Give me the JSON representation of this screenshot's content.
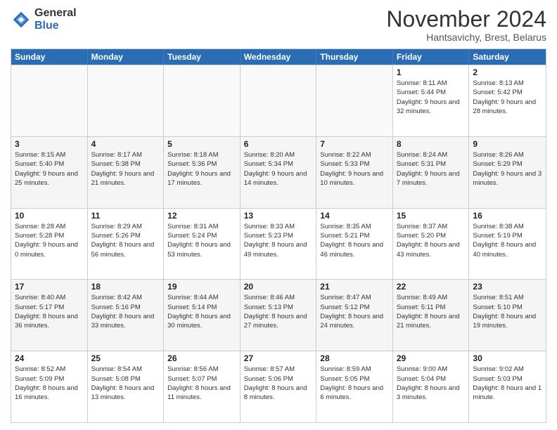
{
  "logo": {
    "general": "General",
    "blue": "Blue"
  },
  "title": "November 2024",
  "subtitle": "Hantsavichy, Brest, Belarus",
  "days": [
    "Sunday",
    "Monday",
    "Tuesday",
    "Wednesday",
    "Thursday",
    "Friday",
    "Saturday"
  ],
  "weeks": [
    [
      {
        "day": "",
        "info": ""
      },
      {
        "day": "",
        "info": ""
      },
      {
        "day": "",
        "info": ""
      },
      {
        "day": "",
        "info": ""
      },
      {
        "day": "",
        "info": ""
      },
      {
        "day": "1",
        "info": "Sunrise: 8:11 AM\nSunset: 5:44 PM\nDaylight: 9 hours and 32 minutes."
      },
      {
        "day": "2",
        "info": "Sunrise: 8:13 AM\nSunset: 5:42 PM\nDaylight: 9 hours and 28 minutes."
      }
    ],
    [
      {
        "day": "3",
        "info": "Sunrise: 8:15 AM\nSunset: 5:40 PM\nDaylight: 9 hours and 25 minutes."
      },
      {
        "day": "4",
        "info": "Sunrise: 8:17 AM\nSunset: 5:38 PM\nDaylight: 9 hours and 21 minutes."
      },
      {
        "day": "5",
        "info": "Sunrise: 8:18 AM\nSunset: 5:36 PM\nDaylight: 9 hours and 17 minutes."
      },
      {
        "day": "6",
        "info": "Sunrise: 8:20 AM\nSunset: 5:34 PM\nDaylight: 9 hours and 14 minutes."
      },
      {
        "day": "7",
        "info": "Sunrise: 8:22 AM\nSunset: 5:33 PM\nDaylight: 9 hours and 10 minutes."
      },
      {
        "day": "8",
        "info": "Sunrise: 8:24 AM\nSunset: 5:31 PM\nDaylight: 9 hours and 7 minutes."
      },
      {
        "day": "9",
        "info": "Sunrise: 8:26 AM\nSunset: 5:29 PM\nDaylight: 9 hours and 3 minutes."
      }
    ],
    [
      {
        "day": "10",
        "info": "Sunrise: 8:28 AM\nSunset: 5:28 PM\nDaylight: 9 hours and 0 minutes."
      },
      {
        "day": "11",
        "info": "Sunrise: 8:29 AM\nSunset: 5:26 PM\nDaylight: 8 hours and 56 minutes."
      },
      {
        "day": "12",
        "info": "Sunrise: 8:31 AM\nSunset: 5:24 PM\nDaylight: 8 hours and 53 minutes."
      },
      {
        "day": "13",
        "info": "Sunrise: 8:33 AM\nSunset: 5:23 PM\nDaylight: 8 hours and 49 minutes."
      },
      {
        "day": "14",
        "info": "Sunrise: 8:35 AM\nSunset: 5:21 PM\nDaylight: 8 hours and 46 minutes."
      },
      {
        "day": "15",
        "info": "Sunrise: 8:37 AM\nSunset: 5:20 PM\nDaylight: 8 hours and 43 minutes."
      },
      {
        "day": "16",
        "info": "Sunrise: 8:38 AM\nSunset: 5:19 PM\nDaylight: 8 hours and 40 minutes."
      }
    ],
    [
      {
        "day": "17",
        "info": "Sunrise: 8:40 AM\nSunset: 5:17 PM\nDaylight: 8 hours and 36 minutes."
      },
      {
        "day": "18",
        "info": "Sunrise: 8:42 AM\nSunset: 5:16 PM\nDaylight: 8 hours and 33 minutes."
      },
      {
        "day": "19",
        "info": "Sunrise: 8:44 AM\nSunset: 5:14 PM\nDaylight: 8 hours and 30 minutes."
      },
      {
        "day": "20",
        "info": "Sunrise: 8:46 AM\nSunset: 5:13 PM\nDaylight: 8 hours and 27 minutes."
      },
      {
        "day": "21",
        "info": "Sunrise: 8:47 AM\nSunset: 5:12 PM\nDaylight: 8 hours and 24 minutes."
      },
      {
        "day": "22",
        "info": "Sunrise: 8:49 AM\nSunset: 5:11 PM\nDaylight: 8 hours and 21 minutes."
      },
      {
        "day": "23",
        "info": "Sunrise: 8:51 AM\nSunset: 5:10 PM\nDaylight: 8 hours and 19 minutes."
      }
    ],
    [
      {
        "day": "24",
        "info": "Sunrise: 8:52 AM\nSunset: 5:09 PM\nDaylight: 8 hours and 16 minutes."
      },
      {
        "day": "25",
        "info": "Sunrise: 8:54 AM\nSunset: 5:08 PM\nDaylight: 8 hours and 13 minutes."
      },
      {
        "day": "26",
        "info": "Sunrise: 8:56 AM\nSunset: 5:07 PM\nDaylight: 8 hours and 11 minutes."
      },
      {
        "day": "27",
        "info": "Sunrise: 8:57 AM\nSunset: 5:06 PM\nDaylight: 8 hours and 8 minutes."
      },
      {
        "day": "28",
        "info": "Sunrise: 8:59 AM\nSunset: 5:05 PM\nDaylight: 8 hours and 6 minutes."
      },
      {
        "day": "29",
        "info": "Sunrise: 9:00 AM\nSunset: 5:04 PM\nDaylight: 8 hours and 3 minutes."
      },
      {
        "day": "30",
        "info": "Sunrise: 9:02 AM\nSunset: 5:03 PM\nDaylight: 8 hours and 1 minute."
      }
    ]
  ]
}
